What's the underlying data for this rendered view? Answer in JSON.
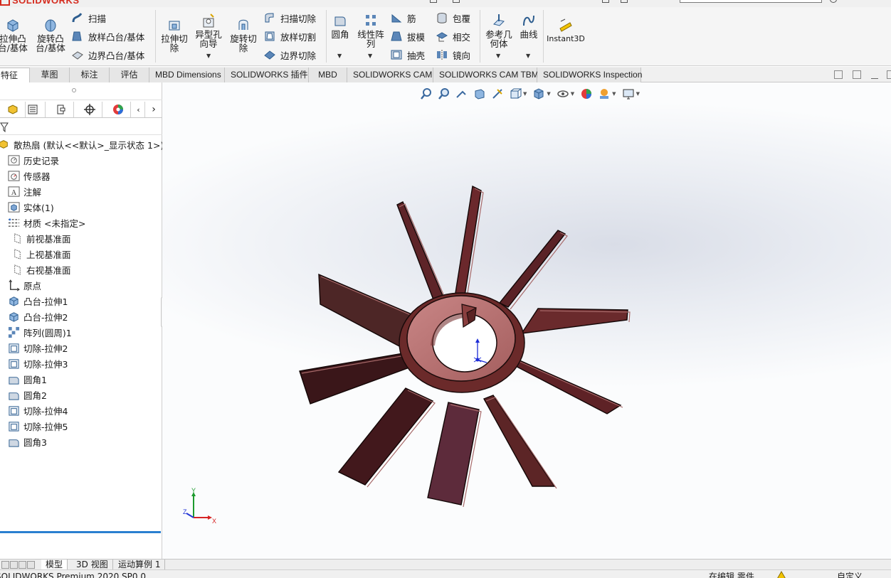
{
  "app": {
    "brand": "SOLIDWORKS",
    "status_left": "SOLIDWORKS Premium 2020 SP0.0",
    "status_editing": "在编辑 零件",
    "status_units": "自定义"
  },
  "ribbon": {
    "extrude_boss": "拉伸凸台/基体",
    "revolve_boss": "旋转凸台/基体",
    "sweep": "扫描",
    "loft_boss": "放样凸台/基体",
    "boundary_boss": "边界凸台/基体",
    "extrude_cut": "拉伸切除",
    "hole_wizard": "异型孔向导",
    "revolve_cut": "旋转切除",
    "swept_cut": "扫描切除",
    "lofted_cut": "放样切割",
    "boundary_cut": "边界切除",
    "fillet": "圆角",
    "linear_pattern": "线性阵列",
    "rib": "筋",
    "draft": "拔模",
    "shell": "抽壳",
    "wrap": "包覆",
    "intersect": "相交",
    "mirror": "镜向",
    "ref_geometry": "参考几何体",
    "curves": "曲线",
    "instant3d": "Instant3D"
  },
  "tabs": [
    "特征",
    "草图",
    "标注",
    "评估",
    "MBD Dimensions",
    "SOLIDWORKS 插件",
    "MBD",
    "SOLIDWORKS CAM",
    "SOLIDWORKS CAM TBM",
    "SOLIDWORKS Inspection"
  ],
  "tree": {
    "root": "散热扇 (默认<<默认>_显示状态 1>)",
    "items": [
      "历史记录",
      "传感器",
      "注解",
      "实体(1)",
      "材质 <未指定>",
      "前视基准面",
      "上视基准面",
      "右视基准面",
      "原点",
      "凸台-拉伸1",
      "凸台-拉伸2",
      "阵列(圆周)1",
      "切除-拉伸2",
      "切除-拉伸3",
      "圆角1",
      "圆角2",
      "切除-拉伸4",
      "切除-拉伸5",
      "圆角3"
    ]
  },
  "bottom_tabs": [
    "模型",
    "3D 视图",
    "运动算例 1"
  ],
  "triad": {
    "x": "X",
    "y": "Y",
    "z": "Z"
  },
  "colors": {
    "blade": "#6b2a2a",
    "hub": "#b57272",
    "accent_blue": "#2a7fd0",
    "viewport_bg": "#e9ecf2"
  }
}
